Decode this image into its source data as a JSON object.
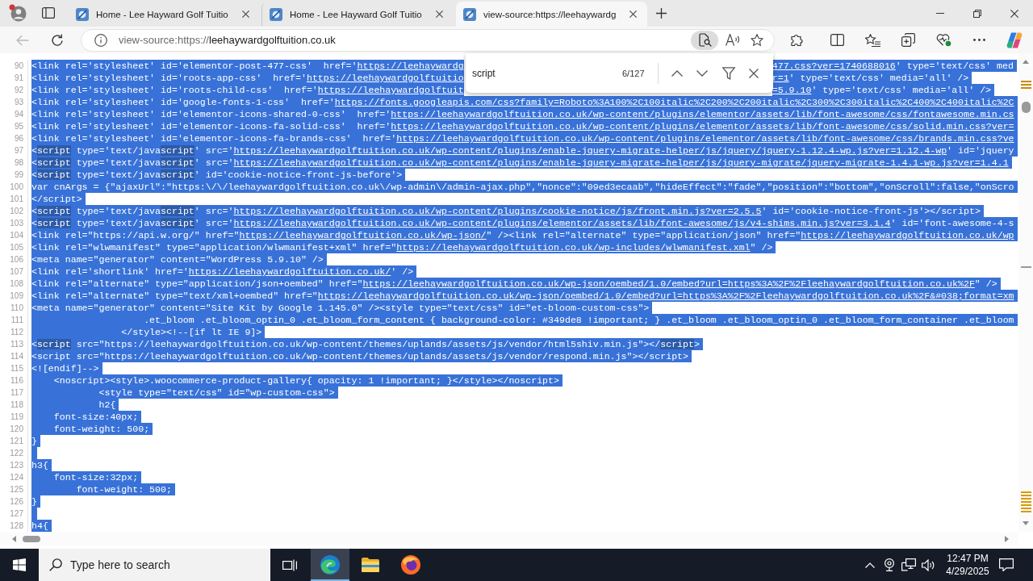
{
  "browser": {
    "tabs": [
      {
        "title": "Home - Lee Hayward Golf Tuitio",
        "selected": false
      },
      {
        "title": "Home - Lee Hayward Golf Tuitio",
        "selected": false
      },
      {
        "title": "view-source:https://leehaywardg",
        "selected": true
      }
    ],
    "back": {
      "disabled": true
    },
    "address": {
      "scheme": "view-source:https://",
      "host": "leehaywardgolftuition.co.uk"
    },
    "find_in_page_active": true
  },
  "find_bar": {
    "query": "script",
    "count": "6/127"
  },
  "source": {
    "lines": [
      {
        "number": "90",
        "kind": "split",
        "selected": true,
        "left": [
          {
            "kind": "text",
            "text": "<link rel='stylesheet' id='elementor-post-477-css'  href='"
          },
          {
            "kind": "link",
            "text": "https://leehaywardg"
          }
        ],
        "right": [
          {
            "kind": "link",
            "text": "477.css?ver=1740688016"
          },
          {
            "kind": "text",
            "text": "' type='text/css' med"
          }
        ]
      },
      {
        "number": "91",
        "kind": "split",
        "selected": true,
        "left": [
          {
            "kind": "text",
            "text": "<link rel='stylesheet' id='roots-app-css'  href='"
          },
          {
            "kind": "link",
            "text": "https://leehaywardgolftuitio"
          }
        ],
        "right": [
          {
            "kind": "link",
            "text": "r=1"
          },
          {
            "kind": "text",
            "text": "' type='text/css' media='all' />"
          }
        ]
      },
      {
        "number": "92",
        "kind": "split",
        "selected": true,
        "left": [
          {
            "kind": "text",
            "text": "<link rel='stylesheet' id='roots-child-css'  href='"
          },
          {
            "kind": "link",
            "text": "https://leehaywardgolftuit"
          }
        ],
        "right": [
          {
            "kind": "link",
            "text": "=5.9.10"
          },
          {
            "kind": "text",
            "text": "' type='text/css' media='all' />"
          }
        ]
      },
      {
        "number": "93",
        "kind": "code",
        "selected": true,
        "segments": [
          {
            "kind": "text",
            "text": "<link rel='stylesheet' id='google-fonts-1-css'  href='"
          },
          {
            "kind": "link",
            "text": "https://fonts.googleapis.com/css?family=Roboto%3A100%2C100italic%2C200%2C200italic%2C300%2C300italic%2C400%2C400italic%2C"
          }
        ]
      },
      {
        "number": "94",
        "kind": "code",
        "selected": true,
        "segments": [
          {
            "kind": "text",
            "text": "<link rel='stylesheet' id='elementor-icons-shared-0-css'  href='"
          },
          {
            "kind": "link",
            "text": "https://leehaywardgolftuition.co.uk/wp-content/plugins/elementor/assets/lib/font-awesome/css/fontawesome.min.cs"
          }
        ]
      },
      {
        "number": "95",
        "kind": "code",
        "selected": true,
        "segments": [
          {
            "kind": "text",
            "text": "<link rel='stylesheet' id='elementor-icons-fa-solid-css'  href='"
          },
          {
            "kind": "link",
            "text": "https://leehaywardgolftuition.co.uk/wp-content/plugins/elementor/assets/lib/font-awesome/css/solid.min.css?ver="
          }
        ]
      },
      {
        "number": "96",
        "kind": "code",
        "selected": true,
        "segments": [
          {
            "kind": "text",
            "text": "<link rel='stylesheet' id='elementor-icons-fa-brands-css'  href='"
          },
          {
            "kind": "link",
            "text": "https://leehaywardgolftuition.co.uk/wp-content/plugins/elementor/assets/lib/font-awesome/css/brands.min.css?ve"
          }
        ]
      },
      {
        "number": "97",
        "kind": "code",
        "selected": true,
        "segments": [
          {
            "kind": "text",
            "text": "<"
          },
          {
            "kind": "match",
            "text": "script"
          },
          {
            "kind": "text",
            "text": " type='text/java"
          },
          {
            "kind": "match",
            "text": "script"
          },
          {
            "kind": "text",
            "text": "' src='"
          },
          {
            "kind": "link",
            "text": "https://leehaywardgolftuition.co.uk/wp-content/plugins/enable-jquery-migrate-helper/js/jquery/jquery-1.12.4-wp.js?ver=1.12.4-wp"
          },
          {
            "kind": "text",
            "text": "' id='jquery"
          }
        ]
      },
      {
        "number": "98",
        "kind": "code",
        "selected": true,
        "segments": [
          {
            "kind": "text",
            "text": "<"
          },
          {
            "kind": "match",
            "text": "script"
          },
          {
            "kind": "text",
            "text": " type='text/java"
          },
          {
            "kind": "match",
            "text": "script"
          },
          {
            "kind": "text",
            "text": "' src='"
          },
          {
            "kind": "link",
            "text": "https://leehaywardgolftuition.co.uk/wp-content/plugins/enable-jquery-migrate-helper/js/jquery-migrate/jquery-migrate-1.4.1-wp.js?ver=1.4.1"
          }
        ]
      },
      {
        "number": "99",
        "kind": "code",
        "selected": true,
        "segments": [
          {
            "kind": "text",
            "text": "<"
          },
          {
            "kind": "match",
            "text": "script"
          },
          {
            "kind": "text",
            "text": " type='text/java"
          },
          {
            "kind": "match",
            "text": "script"
          },
          {
            "kind": "text",
            "text": "' id='cookie-notice-front-js-before'>"
          }
        ]
      },
      {
        "number": "100",
        "kind": "code",
        "selected": true,
        "segments": [
          {
            "kind": "text",
            "text": "var cnArgs = {\"ajaxUrl\":\"https:\\/\\/leehaywardgolftuition.co.uk\\/wp-admin\\/admin-ajax.php\",\"nonce\":\"09ed3ecaab\",\"hideEffect\":\"fade\",\"position\":\"bottom\",\"onScroll\":false,\"onScro"
          }
        ]
      },
      {
        "number": "101",
        "kind": "code",
        "selected": true,
        "segments": [
          {
            "kind": "text",
            "text": "</script>"
          }
        ]
      },
      {
        "number": "102",
        "kind": "code",
        "selected": true,
        "segments": [
          {
            "kind": "text",
            "text": "<"
          },
          {
            "kind": "match",
            "text": "script"
          },
          {
            "kind": "text",
            "text": " type='text/java"
          },
          {
            "kind": "match",
            "text": "script"
          },
          {
            "kind": "text",
            "text": "' src='"
          },
          {
            "kind": "link",
            "text": "https://leehaywardgolftuition.co.uk/wp-content/plugins/cookie-notice/js/front.min.js?ver=2.5.5"
          },
          {
            "kind": "text",
            "text": "' id='cookie-notice-front-js'></script>"
          }
        ]
      },
      {
        "number": "103",
        "kind": "code",
        "selected": true,
        "segments": [
          {
            "kind": "text",
            "text": "<"
          },
          {
            "kind": "match",
            "text": "script"
          },
          {
            "kind": "text",
            "text": " type='text/java"
          },
          {
            "kind": "match",
            "text": "script"
          },
          {
            "kind": "text",
            "text": "' src='"
          },
          {
            "kind": "link",
            "text": "https://leehaywardgolftuition.co.uk/wp-content/plugins/elementor/assets/lib/font-awesome/js/v4-shims.min.js?ver=3.1.4"
          },
          {
            "kind": "text",
            "text": "' id='font-awesome-4-s"
          }
        ]
      },
      {
        "number": "104",
        "kind": "code",
        "selected": true,
        "segments": [
          {
            "kind": "text",
            "text": "<link rel=\"https://api.w.org/\" href=\""
          },
          {
            "kind": "link",
            "text": "https://leehaywardgolftuition.co.uk/wp-json/"
          },
          {
            "kind": "text",
            "text": "\" /><link rel=\"alternate\" type=\"application/json\" href=\""
          },
          {
            "kind": "link",
            "text": "https://leehaywardgolftuition.co.uk/wp"
          }
        ]
      },
      {
        "number": "105",
        "kind": "code",
        "selected": true,
        "segments": [
          {
            "kind": "text",
            "text": "<link rel=\"wlwmanifest\" type=\"application/wlwmanifest+xml\" href=\""
          },
          {
            "kind": "link",
            "text": "https://leehaywardgolftuition.co.uk/wp-includes/wlwmanifest.xml"
          },
          {
            "kind": "text",
            "text": "\" />"
          }
        ]
      },
      {
        "number": "106",
        "kind": "code",
        "selected": true,
        "segments": [
          {
            "kind": "text",
            "text": "<meta name=\"generator\" content=\"WordPress 5.9.10\" />"
          }
        ]
      },
      {
        "number": "107",
        "kind": "code",
        "selected": true,
        "segments": [
          {
            "kind": "text",
            "text": "<link rel='shortlink' href='"
          },
          {
            "kind": "link",
            "text": "https://leehaywardgolftuition.co.uk/"
          },
          {
            "kind": "text",
            "text": "' />"
          }
        ]
      },
      {
        "number": "108",
        "kind": "code",
        "selected": true,
        "segments": [
          {
            "kind": "text",
            "text": "<link rel=\"alternate\" type=\"application/json+oembed\" href=\""
          },
          {
            "kind": "link",
            "text": "https://leehaywardgolftuition.co.uk/wp-json/oembed/1.0/embed?url=https%3A%2F%2Fleehaywardgolftuition.co.uk%2F"
          },
          {
            "kind": "text",
            "text": "\" />"
          }
        ]
      },
      {
        "number": "109",
        "kind": "code",
        "selected": true,
        "segments": [
          {
            "kind": "text",
            "text": "<link rel=\"alternate\" type=\"text/xml+oembed\" href=\""
          },
          {
            "kind": "link",
            "text": "https://leehaywardgolftuition.co.uk/wp-json/oembed/1.0/embed?url=https%3A%2F%2Fleehaywardgolftuition.co.uk%2F&#038;format=xm"
          }
        ]
      },
      {
        "number": "110",
        "kind": "code",
        "selected": true,
        "segments": [
          {
            "kind": "text",
            "text": "<meta name=\"generator\" content=\"Site Kit by Google 1.145.0\" /><style type=\"text/css\" id=\"et-bloom-custom-css\">"
          }
        ]
      },
      {
        "number": "111",
        "kind": "code",
        "selected": true,
        "segments": [
          {
            "kind": "text",
            "text": "                    .et_bloom .et_bloom_optin_0 .et_bloom_form_content { background-color: #349de8 !important; } .et_bloom .et_bloom_optin_0 .et_bloom_form_container .et_bloom"
          }
        ]
      },
      {
        "number": "112",
        "kind": "code",
        "selected": true,
        "segments": [
          {
            "kind": "text",
            "text": "                </style><!--[if lt IE 9]>"
          }
        ]
      },
      {
        "number": "113",
        "kind": "code",
        "selected": true,
        "segments": [
          {
            "kind": "text",
            "text": "<"
          },
          {
            "kind": "match",
            "text": "script"
          },
          {
            "kind": "text",
            "text": " src=\"https://leehaywardgolftuition.co.uk/wp-content/themes/uplands/assets/js/vendor/html5shiv.min.js\"></"
          },
          {
            "kind": "match",
            "text": "script"
          },
          {
            "kind": "text",
            "text": ">"
          }
        ]
      },
      {
        "number": "114",
        "kind": "code",
        "selected": true,
        "segments": [
          {
            "kind": "text",
            "text": "<script src=\"https://leehaywardgolftuition.co.uk/wp-content/themes/uplands/assets/js/vendor/respond.min.js\"></script>"
          }
        ]
      },
      {
        "number": "115",
        "kind": "code",
        "selected": true,
        "segments": [
          {
            "kind": "text",
            "text": "<![endif]-->"
          }
        ]
      },
      {
        "number": "116",
        "kind": "code",
        "selected": true,
        "segments": [
          {
            "kind": "text",
            "text": "    <noscript><style>.woocommerce-product-gallery{ opacity: 1 !important; }</style></noscript>"
          }
        ]
      },
      {
        "number": "117",
        "kind": "code",
        "selected": true,
        "segments": [
          {
            "kind": "text",
            "text": "            <style type=\"text/css\" id=\"wp-custom-css\">"
          }
        ]
      },
      {
        "number": "118",
        "kind": "code",
        "selected": true,
        "segments": [
          {
            "kind": "text",
            "text": "            h2{"
          }
        ]
      },
      {
        "number": "119",
        "kind": "code",
        "selected": true,
        "segments": [
          {
            "kind": "text",
            "text": "    font-size:40px;"
          }
        ]
      },
      {
        "number": "120",
        "kind": "code",
        "selected": true,
        "segments": [
          {
            "kind": "text",
            "text": "    font-weight: 500;"
          }
        ]
      },
      {
        "number": "121",
        "kind": "code",
        "selected": true,
        "segments": [
          {
            "kind": "text",
            "text": "}"
          }
        ]
      },
      {
        "number": "122",
        "kind": "blank",
        "selected": true
      },
      {
        "number": "123",
        "kind": "code",
        "selected": true,
        "segments": [
          {
            "kind": "text",
            "text": "h3{"
          }
        ]
      },
      {
        "number": "124",
        "kind": "code",
        "selected": true,
        "segments": [
          {
            "kind": "text",
            "text": "    font-size:32px;"
          }
        ]
      },
      {
        "number": "125",
        "kind": "code",
        "selected": true,
        "segments": [
          {
            "kind": "text",
            "text": "        font-weight: 500;"
          }
        ]
      },
      {
        "number": "126",
        "kind": "code",
        "selected": true,
        "segments": [
          {
            "kind": "text",
            "text": "}"
          }
        ]
      },
      {
        "number": "127",
        "kind": "blank",
        "selected": true
      },
      {
        "number": "128",
        "kind": "code",
        "selected": true,
        "segments": [
          {
            "kind": "text",
            "text": "h4{"
          }
        ]
      }
    ]
  },
  "taskbar": {
    "search": {
      "placeholder": "Type here to search"
    },
    "apps": [
      {
        "kind": "edge",
        "active": true
      },
      {
        "kind": "explorer",
        "active": false
      },
      {
        "kind": "firefox",
        "active": false
      }
    ],
    "time": "12:47 PM",
    "date": "4/29/2025"
  }
}
